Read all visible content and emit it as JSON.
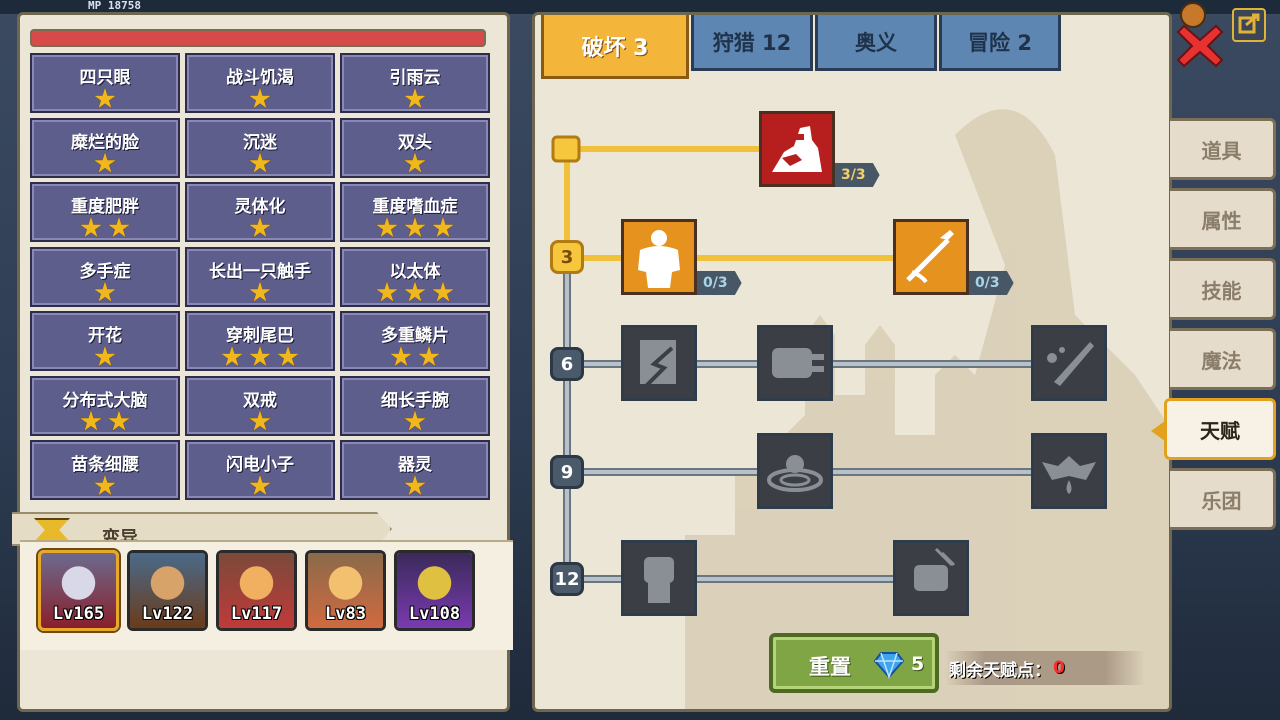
{
  "top_hud": {
    "text": "MP 18758"
  },
  "traits": [
    {
      "name": "四只眼",
      "stars": 1
    },
    {
      "name": "战斗饥渴",
      "stars": 1
    },
    {
      "name": "引雨云",
      "stars": 1
    },
    {
      "name": "糜烂的脸",
      "stars": 1
    },
    {
      "name": "沉迷",
      "stars": 1
    },
    {
      "name": "双头",
      "stars": 1
    },
    {
      "name": "重度肥胖",
      "stars": 2
    },
    {
      "name": "灵体化",
      "stars": 1
    },
    {
      "name": "重度嗜血症",
      "stars": 3
    },
    {
      "name": "多手症",
      "stars": 1
    },
    {
      "name": "长出一只触手",
      "stars": 1
    },
    {
      "name": "以太体",
      "stars": 3
    },
    {
      "name": "开花",
      "stars": 1
    },
    {
      "name": "穿刺尾巴",
      "stars": 3
    },
    {
      "name": "多重鳞片",
      "stars": 2
    },
    {
      "name": "分布式大脑",
      "stars": 2
    },
    {
      "name": "双戒",
      "stars": 1
    },
    {
      "name": "细长手腕",
      "stars": 1
    },
    {
      "name": "苗条细腰",
      "stars": 1
    },
    {
      "name": "闪电小子",
      "stars": 1
    },
    {
      "name": "器灵",
      "stars": 1
    }
  ],
  "section": {
    "label": "变异"
  },
  "heroes": [
    {
      "level": "Lv165",
      "selected": true
    },
    {
      "level": "Lv122",
      "selected": false
    },
    {
      "level": "Lv117",
      "selected": false
    },
    {
      "level": "Lv83",
      "selected": false
    },
    {
      "level": "Lv108",
      "selected": false
    }
  ],
  "tabs": [
    {
      "label": "破坏 3",
      "active": true
    },
    {
      "label": "狩猎 12",
      "active": false
    },
    {
      "label": "奥义",
      "active": false
    },
    {
      "label": "冒险 2",
      "active": false
    }
  ],
  "tiers": [
    "3",
    "6",
    "9",
    "12"
  ],
  "talent_counts": {
    "arm_wrestle": "3/3",
    "body": "0/3",
    "arrow": "0/3"
  },
  "reset": {
    "label": "重置",
    "cost": "5"
  },
  "remaining_points": {
    "label": "剩余天赋点：",
    "value": "0"
  },
  "side_nav": [
    {
      "label": "道具",
      "active": false
    },
    {
      "label": "属性",
      "active": false
    },
    {
      "label": "技能",
      "active": false
    },
    {
      "label": "魔法",
      "active": false
    },
    {
      "label": "天赋",
      "active": true
    },
    {
      "label": "乐团",
      "active": false
    }
  ],
  "colors": {
    "accent_gold": "#f3b63a",
    "locked_node": "#3b3f45",
    "points_zero": "#ff2a2a"
  }
}
